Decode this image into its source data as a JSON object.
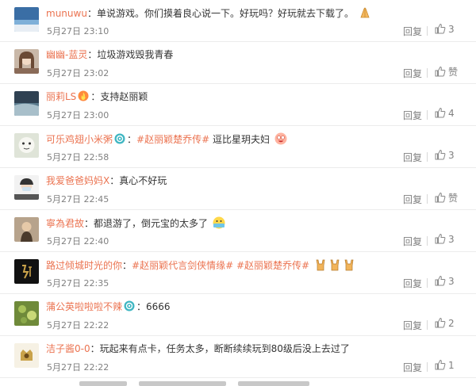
{
  "comments": [
    {
      "user": "munuwu",
      "text": "单说游戏。你们摸着良心说一下。好玩吗？好玩就去下载了。",
      "time": "5月27日 23:10",
      "reply": "回复",
      "likes": "3",
      "emoji": "hands"
    },
    {
      "user": "幽幽-蓝灵",
      "text": "垃圾游戏毁我青春",
      "time": "5月27日 23:02",
      "reply": "回复",
      "likes": "赞"
    },
    {
      "user": "丽莉LS",
      "text": "支持赵丽颖",
      "time": "5月27日 23:00",
      "reply": "回复",
      "likes": "4",
      "badge": "flame"
    },
    {
      "user": "可乐鸡翅小米粥",
      "topic": "#赵丽颖楚乔传#",
      "text": "逗比星玥夫妇",
      "time": "5月27日 22:58",
      "reply": "回复",
      "likes": "3",
      "badge": "vip",
      "emoji": "crazy"
    },
    {
      "user": "我爱爸爸妈妈X",
      "text": "真心不好玩",
      "time": "5月27日 22:45",
      "reply": "回复",
      "likes": "赞"
    },
    {
      "user": "寧為君故",
      "text": "都退游了，倒元宝的太多了",
      "time": "5月27日 22:40",
      "reply": "回复",
      "likes": "3",
      "emoji": "money"
    },
    {
      "user": "路过倾城时光的你",
      "topic": "#赵丽颖代言剑侠情缘# #赵丽颖楚乔传#",
      "text": "",
      "time": "5月27日 22:35",
      "reply": "回复",
      "likes": "3",
      "emoji": "rock3"
    },
    {
      "user": "蒲公英啦啦啦不辣",
      "text": "6666",
      "time": "5月27日 22:22",
      "reply": "回复",
      "likes": "2",
      "badge": "vip"
    },
    {
      "user": "洁子酱0-0",
      "text": "玩起来有点卡，任务太多，断断续续玩到80级后没上去过了",
      "time": "5月27日 22:22",
      "reply": "回复",
      "likes": "1"
    }
  ]
}
